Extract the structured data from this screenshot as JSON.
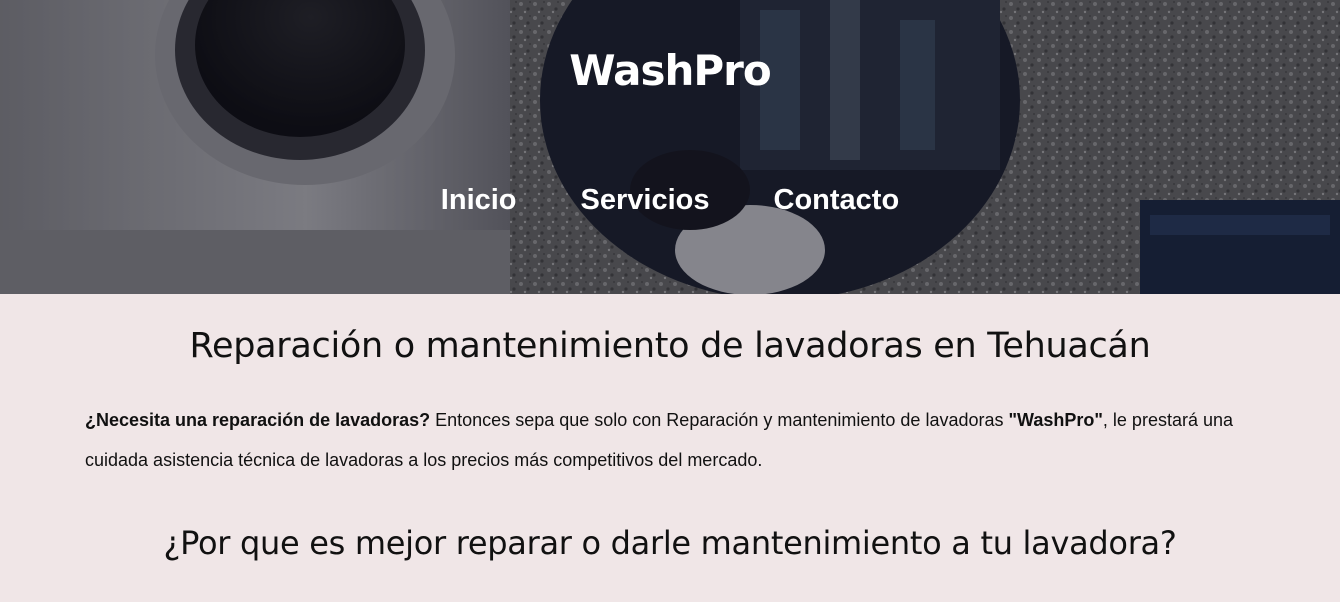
{
  "header": {
    "brand": "WashPro",
    "nav": [
      "Inicio",
      "Servicios",
      "Contacto"
    ]
  },
  "main": {
    "title": "Reparación o mantenimiento de lavadoras en Tehuacán",
    "intro": {
      "lead_bold": "¿Necesita una reparación de lavadoras?",
      "text_1": " Entonces sepa que solo con Reparación y mantenimiento de lavadoras ",
      "brand_bold": "\"WashPro\"",
      "text_2": ", le prestará una cuidada asistencia técnica de lavadoras a los precios más competitivos del mercado."
    },
    "subtitle": "¿Por que es mejor reparar o darle mantenimiento a tu lavadora?"
  },
  "colors": {
    "page_background": "#f0e6e7",
    "text": "#111111",
    "hero_text": "#ffffff"
  }
}
